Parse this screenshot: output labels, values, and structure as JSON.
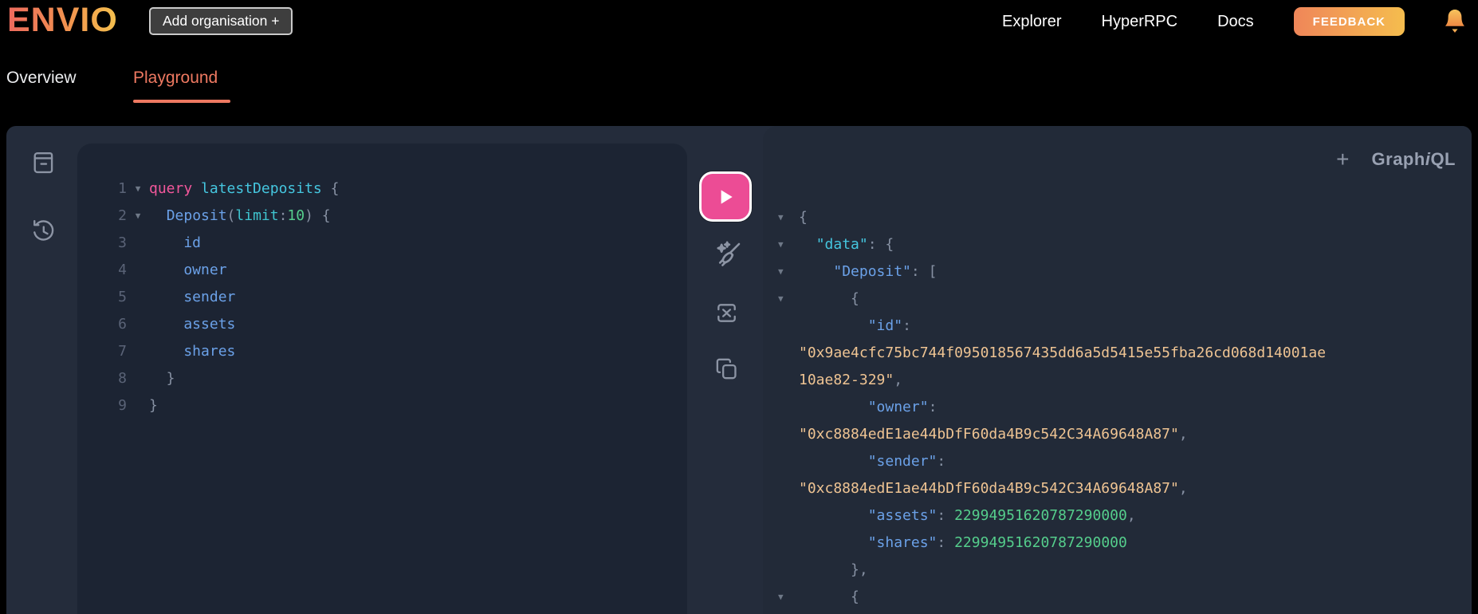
{
  "header": {
    "logo": "ENVIO",
    "add_org_button": "Add organisation +",
    "nav": [
      "Explorer",
      "HyperRPC",
      "Docs"
    ],
    "feedback_button": "FEEDBACK"
  },
  "tabs": {
    "overview": "Overview",
    "playground": "Playground",
    "active": "Playground"
  },
  "graphiql": {
    "session_header": {
      "new_tab": "+",
      "brand_pre": "Graph",
      "brand_i": "i",
      "brand_post": "QL"
    },
    "query_editor": {
      "lines": [
        {
          "n": "1",
          "fold": true,
          "tokens": [
            {
              "t": "query",
              "c": "kw"
            },
            {
              "t": " ",
              "c": "pun"
            },
            {
              "t": "latestDeposits",
              "c": "def"
            },
            {
              "t": " {",
              "c": "pun"
            }
          ]
        },
        {
          "n": "2",
          "fold": true,
          "tokens": [
            {
              "t": "  ",
              "c": "pun"
            },
            {
              "t": "Deposit",
              "c": "prop"
            },
            {
              "t": "(",
              "c": "pun"
            },
            {
              "t": "limit",
              "c": "attr"
            },
            {
              "t": ":",
              "c": "pun"
            },
            {
              "t": "10",
              "c": "num"
            },
            {
              "t": ") {",
              "c": "pun"
            }
          ]
        },
        {
          "n": "3",
          "tokens": [
            {
              "t": "    id",
              "c": "prop"
            }
          ]
        },
        {
          "n": "4",
          "tokens": [
            {
              "t": "    owner",
              "c": "prop"
            }
          ]
        },
        {
          "n": "5",
          "tokens": [
            {
              "t": "    sender",
              "c": "prop"
            }
          ]
        },
        {
          "n": "6",
          "tokens": [
            {
              "t": "    assets",
              "c": "prop"
            }
          ]
        },
        {
          "n": "7",
          "tokens": [
            {
              "t": "    shares",
              "c": "prop"
            }
          ]
        },
        {
          "n": "8",
          "tokens": [
            {
              "t": "  }",
              "c": "pun"
            }
          ]
        },
        {
          "n": "9",
          "tokens": [
            {
              "t": "}",
              "c": "pun"
            }
          ]
        }
      ]
    },
    "response": {
      "lines": [
        {
          "fold": true,
          "tokens": [
            {
              "t": "{",
              "c": "pun"
            }
          ]
        },
        {
          "fold": true,
          "tokens": [
            {
              "t": "  ",
              "c": "pun"
            },
            {
              "t": "\"data\"",
              "c": "def"
            },
            {
              "t": ": {",
              "c": "pun"
            }
          ]
        },
        {
          "fold": true,
          "tokens": [
            {
              "t": "    ",
              "c": "pun"
            },
            {
              "t": "\"Deposit\"",
              "c": "prop"
            },
            {
              "t": ": [",
              "c": "pun"
            }
          ]
        },
        {
          "fold": true,
          "tokens": [
            {
              "t": "      {",
              "c": "pun"
            }
          ]
        },
        {
          "tokens": [
            {
              "t": "        ",
              "c": "pun"
            },
            {
              "t": "\"id\"",
              "c": "prop"
            },
            {
              "t": ":",
              "c": "pun"
            }
          ]
        },
        {
          "tokens": [
            {
              "t": "\"0x9ae4cfc75bc744f095018567435dd6a5d5415e55fba26cd068d14001ae",
              "c": "str"
            }
          ]
        },
        {
          "tokens": [
            {
              "t": "10ae82-329\"",
              "c": "str"
            },
            {
              "t": ",",
              "c": "pun"
            }
          ]
        },
        {
          "tokens": [
            {
              "t": "        ",
              "c": "pun"
            },
            {
              "t": "\"owner\"",
              "c": "prop"
            },
            {
              "t": ":",
              "c": "pun"
            }
          ]
        },
        {
          "tokens": [
            {
              "t": "\"0xc8884edE1ae44bDfF60da4B9c542C34A69648A87\"",
              "c": "str"
            },
            {
              "t": ",",
              "c": "pun"
            }
          ]
        },
        {
          "tokens": [
            {
              "t": "        ",
              "c": "pun"
            },
            {
              "t": "\"sender\"",
              "c": "prop"
            },
            {
              "t": ":",
              "c": "pun"
            }
          ]
        },
        {
          "tokens": [
            {
              "t": "\"0xc8884edE1ae44bDfF60da4B9c542C34A69648A87\"",
              "c": "str"
            },
            {
              "t": ",",
              "c": "pun"
            }
          ]
        },
        {
          "tokens": [
            {
              "t": "        ",
              "c": "pun"
            },
            {
              "t": "\"assets\"",
              "c": "prop"
            },
            {
              "t": ": ",
              "c": "pun"
            },
            {
              "t": "22994951620787290000",
              "c": "num"
            },
            {
              "t": ",",
              "c": "pun"
            }
          ]
        },
        {
          "tokens": [
            {
              "t": "        ",
              "c": "pun"
            },
            {
              "t": "\"shares\"",
              "c": "prop"
            },
            {
              "t": ": ",
              "c": "pun"
            },
            {
              "t": "22994951620787290000",
              "c": "num"
            }
          ]
        },
        {
          "tokens": [
            {
              "t": "      },",
              "c": "pun"
            }
          ]
        },
        {
          "fold": true,
          "tokens": [
            {
              "t": "      {",
              "c": "pun"
            }
          ]
        }
      ]
    }
  },
  "colors": {
    "accent_pink_execute": "#EC4C95",
    "accent_salmon_tab": "#EE7961",
    "brand_gradient_start": "#ED6A5E",
    "brand_gradient_end": "#F5C14E",
    "feedback_gradient_start": "#EF8659",
    "feedback_gradient_end": "#F5BD4E"
  }
}
